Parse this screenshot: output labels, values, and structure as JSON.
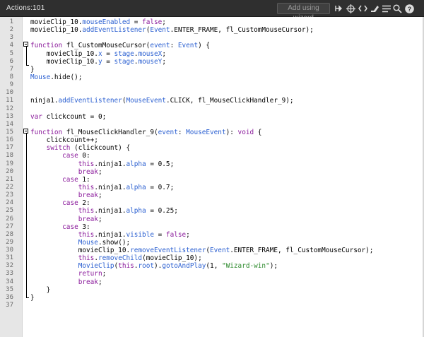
{
  "panel": {
    "title": "Actions:101"
  },
  "toolbar": {
    "wizard_label": "Add using wizard",
    "icons": [
      "pin-icon",
      "target-icon",
      "code-brackets-icon",
      "find-replace-icon",
      "lines-icon",
      "search-icon",
      "help-icon"
    ]
  },
  "colors": {
    "plain": "#000000",
    "keyword": "#8a1a9b",
    "property": "#2a5fd1",
    "string": "#2e8b2e",
    "gutter_bg": "#e6e6e6",
    "toolbar_bg": "#2f2f2f"
  },
  "editor": {
    "line_numbers": [
      "1",
      "2",
      "3",
      "4",
      "5",
      "6",
      "7",
      "8",
      "9",
      "10",
      "11",
      "12",
      "13",
      "14",
      "15",
      "16",
      "17",
      "18",
      "19",
      "20",
      "21",
      "22",
      "23",
      "24",
      "25",
      "26",
      "27",
      "28",
      "29",
      "30",
      "31",
      "32",
      "33",
      "34",
      "35",
      "36",
      "37"
    ],
    "lines": [
      [
        [
          "p",
          "movieClip_10."
        ],
        [
          "b",
          "mouseEnabled"
        ],
        [
          "p",
          " = "
        ],
        [
          "k",
          "false"
        ],
        [
          "p",
          ";"
        ]
      ],
      [
        [
          "p",
          "movieClip_10."
        ],
        [
          "b",
          "addEventListener"
        ],
        [
          "p",
          "("
        ],
        [
          "b",
          "Event"
        ],
        [
          "p",
          ".ENTER_FRAME, fl_CustomMouseCursor);"
        ]
      ],
      [],
      [
        [
          "k",
          "function"
        ],
        [
          "p",
          " fl_CustomMouseCursor("
        ],
        [
          "b",
          "event"
        ],
        [
          "p",
          ": "
        ],
        [
          "b",
          "Event"
        ],
        [
          "p",
          ") {"
        ]
      ],
      [
        [
          "p",
          "    movieClip_10."
        ],
        [
          "b",
          "x"
        ],
        [
          "p",
          " = "
        ],
        [
          "b",
          "stage"
        ],
        [
          "p",
          "."
        ],
        [
          "b",
          "mouseX"
        ],
        [
          "p",
          ";"
        ]
      ],
      [
        [
          "p",
          "    movieClip_10."
        ],
        [
          "b",
          "y"
        ],
        [
          "p",
          " = "
        ],
        [
          "b",
          "stage"
        ],
        [
          "p",
          "."
        ],
        [
          "b",
          "mouseY"
        ],
        [
          "p",
          ";"
        ]
      ],
      [
        [
          "p",
          "}"
        ]
      ],
      [
        [
          "b",
          "Mouse"
        ],
        [
          "p",
          "."
        ],
        [
          "p",
          "hide();"
        ]
      ],
      [],
      [],
      [
        [
          "p",
          "ninja1."
        ],
        [
          "b",
          "addEventListener"
        ],
        [
          "p",
          "("
        ],
        [
          "b",
          "MouseEvent"
        ],
        [
          "p",
          ".CLICK, fl_MouseClickHandler_9);"
        ]
      ],
      [],
      [
        [
          "k",
          "var"
        ],
        [
          "p",
          " clickcount = 0;"
        ]
      ],
      [],
      [
        [
          "k",
          "function"
        ],
        [
          "p",
          " fl_MouseClickHandler_9("
        ],
        [
          "b",
          "event"
        ],
        [
          "p",
          ": "
        ],
        [
          "b",
          "MouseEvent"
        ],
        [
          "p",
          "): "
        ],
        [
          "k",
          "void"
        ],
        [
          "p",
          " {"
        ]
      ],
      [
        [
          "p",
          "    clickcount++;"
        ]
      ],
      [
        [
          "p",
          "    "
        ],
        [
          "k",
          "switch"
        ],
        [
          "p",
          " (clickcount) {"
        ]
      ],
      [
        [
          "p",
          "        "
        ],
        [
          "k",
          "case"
        ],
        [
          "p",
          " 0:"
        ]
      ],
      [
        [
          "p",
          "            "
        ],
        [
          "k",
          "this"
        ],
        [
          "p",
          ".ninja1."
        ],
        [
          "b",
          "alpha"
        ],
        [
          "p",
          " = 0.5;"
        ]
      ],
      [
        [
          "p",
          "            "
        ],
        [
          "k",
          "break"
        ],
        [
          "p",
          ";"
        ]
      ],
      [
        [
          "p",
          "        "
        ],
        [
          "k",
          "case"
        ],
        [
          "p",
          " 1:"
        ]
      ],
      [
        [
          "p",
          "            "
        ],
        [
          "k",
          "this"
        ],
        [
          "p",
          ".ninja1."
        ],
        [
          "b",
          "alpha"
        ],
        [
          "p",
          " = 0.7;"
        ]
      ],
      [
        [
          "p",
          "            "
        ],
        [
          "k",
          "break"
        ],
        [
          "p",
          ";"
        ]
      ],
      [
        [
          "p",
          "        "
        ],
        [
          "k",
          "case"
        ],
        [
          "p",
          " 2:"
        ]
      ],
      [
        [
          "p",
          "            "
        ],
        [
          "k",
          "this"
        ],
        [
          "p",
          ".ninja1."
        ],
        [
          "b",
          "alpha"
        ],
        [
          "p",
          " = 0.25;"
        ]
      ],
      [
        [
          "p",
          "            "
        ],
        [
          "k",
          "break"
        ],
        [
          "p",
          ";"
        ]
      ],
      [
        [
          "p",
          "        "
        ],
        [
          "k",
          "case"
        ],
        [
          "p",
          " 3:"
        ]
      ],
      [
        [
          "p",
          "            "
        ],
        [
          "k",
          "this"
        ],
        [
          "p",
          ".ninja1."
        ],
        [
          "b",
          "visible"
        ],
        [
          "p",
          " = "
        ],
        [
          "k",
          "false"
        ],
        [
          "p",
          ";"
        ]
      ],
      [
        [
          "p",
          "            "
        ],
        [
          "b",
          "Mouse"
        ],
        [
          "p",
          ".show();"
        ]
      ],
      [
        [
          "p",
          "            movieClip_10."
        ],
        [
          "b",
          "removeEventListener"
        ],
        [
          "p",
          "("
        ],
        [
          "b",
          "Event"
        ],
        [
          "p",
          ".ENTER_FRAME, fl_CustomMouseCursor);"
        ]
      ],
      [
        [
          "p",
          "            "
        ],
        [
          "k",
          "this"
        ],
        [
          "p",
          "."
        ],
        [
          "b",
          "removeChild"
        ],
        [
          "p",
          "(movieClip_10);"
        ]
      ],
      [
        [
          "p",
          "            "
        ],
        [
          "b",
          "MovieClip"
        ],
        [
          "p",
          "("
        ],
        [
          "k",
          "this"
        ],
        [
          "p",
          "."
        ],
        [
          "b",
          "root"
        ],
        [
          "p",
          ")."
        ],
        [
          "b",
          "gotoAndPlay"
        ],
        [
          "p",
          "(1, "
        ],
        [
          "s",
          "\"Wizard-win\""
        ],
        [
          "p",
          ");"
        ]
      ],
      [
        [
          "p",
          "            "
        ],
        [
          "k",
          "return"
        ],
        [
          "p",
          ";"
        ]
      ],
      [
        [
          "p",
          "            "
        ],
        [
          "k",
          "break"
        ],
        [
          "p",
          ";"
        ]
      ],
      [
        [
          "p",
          "    }"
        ]
      ],
      [
        [
          "p",
          "}"
        ]
      ],
      []
    ]
  }
}
